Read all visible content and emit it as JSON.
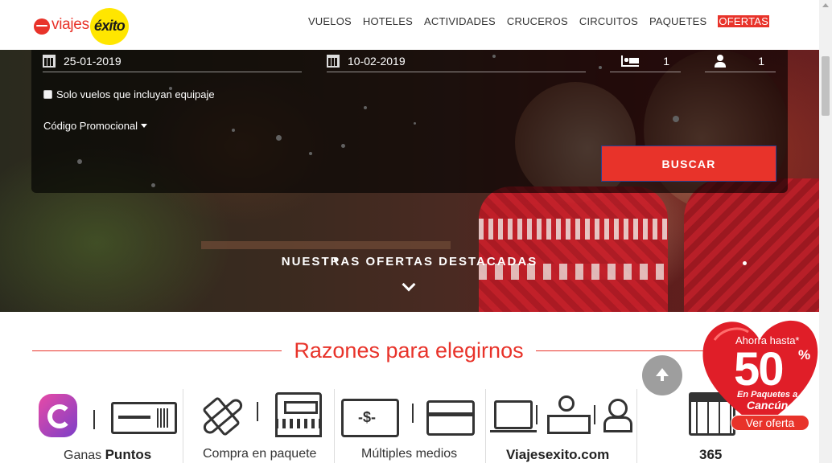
{
  "brand": {
    "name_left": "viajes",
    "name_right": "éxito"
  },
  "nav": {
    "items": [
      "VUELOS",
      "HOTELES",
      "ACTIVIDADES",
      "CRUCEROS",
      "CIRCUITOS",
      "PAQUETES",
      "OFERTAS"
    ]
  },
  "search": {
    "date_from": "25-01-2019",
    "date_to": "10-02-2019",
    "rooms": "1",
    "guests": "1",
    "baggage_label": "Solo vuelos que incluyan equipaje",
    "baggage_checked": false,
    "promo_label": "Código Promocional",
    "search_button": "BUSCAR"
  },
  "hero": {
    "offers_title": "NUESTRAS OFERTAS DESTACADAS"
  },
  "reasons": {
    "title": "Razones para elegirnos",
    "items": [
      {
        "label_prefix": "Ganas ",
        "label_bold": "Puntos"
      },
      {
        "label_prefix": "Compra en paquete",
        "label_bold": ""
      },
      {
        "label_prefix": "Múltiples medios",
        "label_bold": ""
      },
      {
        "label_prefix": "",
        "label_bold": "Viajesexito.com"
      },
      {
        "label_prefix": "",
        "label_bold": "365"
      }
    ]
  },
  "promo_badge": {
    "line1": "Ahorra hasta*",
    "big": "50",
    "pct": "%",
    "line2": "En Paquetes a",
    "line3": "Cancún",
    "cta": "Ver oferta"
  },
  "colors": {
    "accent": "#e8332a",
    "brand_yellow": "#ffe600",
    "button_border": "#2b3f8f"
  }
}
